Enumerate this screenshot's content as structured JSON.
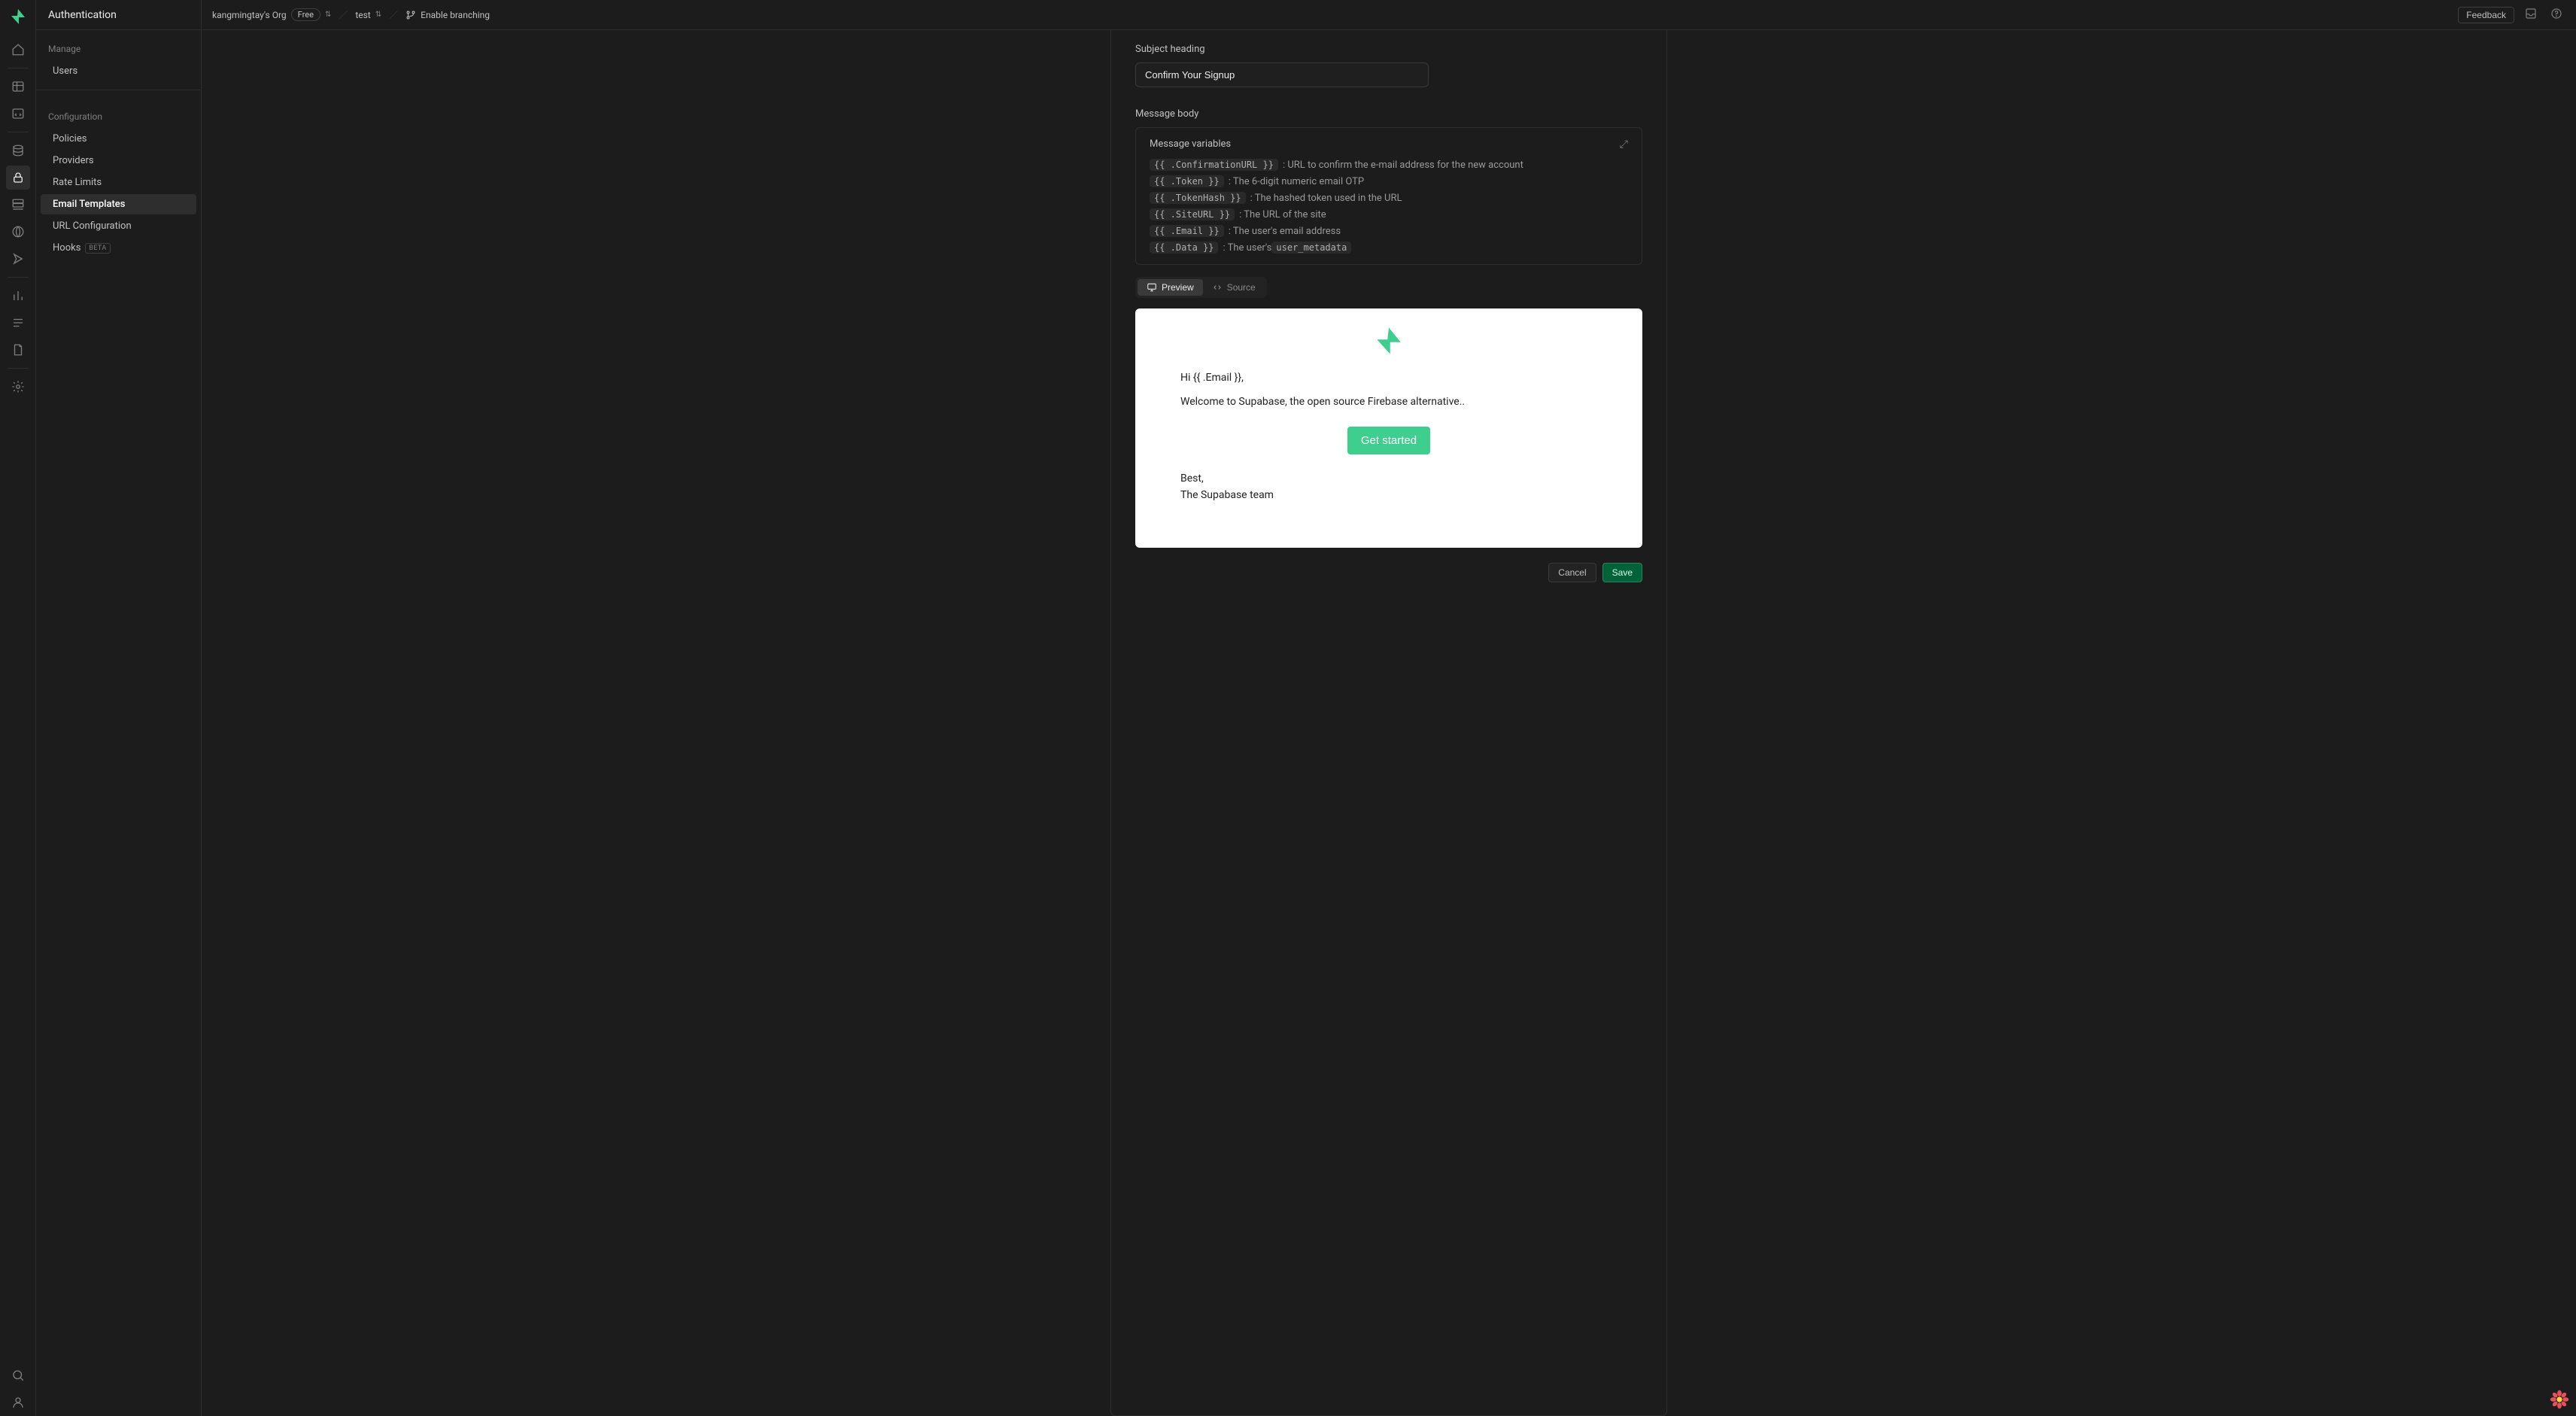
{
  "page_title": "Authentication",
  "topbar": {
    "org": "kangmingtay's Org",
    "plan": "Free",
    "project": "test",
    "branching_label": "Enable branching",
    "feedback_label": "Feedback"
  },
  "sidebar": {
    "sections": {
      "manage_label": "Manage",
      "config_label": "Configuration"
    },
    "manage": [
      {
        "label": "Users",
        "active": false
      }
    ],
    "config": [
      {
        "label": "Policies",
        "active": false
      },
      {
        "label": "Providers",
        "active": false
      },
      {
        "label": "Rate Limits",
        "active": false
      },
      {
        "label": "Email Templates",
        "active": true
      },
      {
        "label": "URL Configuration",
        "active": false
      },
      {
        "label": "Hooks",
        "active": false,
        "badge": "BETA"
      }
    ]
  },
  "form": {
    "subject_label": "Subject heading",
    "subject_value": "Confirm Your Signup",
    "body_label": "Message body",
    "vars_title": "Message variables",
    "variables": [
      {
        "token": "{{ .ConfirmationURL }}",
        "desc": ": URL to confirm the e-mail address for the new account"
      },
      {
        "token": "{{ .Token }}",
        "desc": ": The 6-digit numeric email OTP"
      },
      {
        "token": "{{ .TokenHash }}",
        "desc": ": The hashed token used in the URL"
      },
      {
        "token": "{{ .SiteURL }}",
        "desc": ": The URL of the site"
      },
      {
        "token": "{{ .Email }}",
        "desc": ": The user's email address"
      },
      {
        "token": "{{ .Data }}",
        "desc_pre": ": The user's ",
        "desc_code": "user_metadata"
      }
    ],
    "tabs": {
      "preview": "Preview",
      "source": "Source"
    },
    "actions": {
      "cancel": "Cancel",
      "save": "Save"
    }
  },
  "email_preview": {
    "greeting": "Hi {{ .Email }},",
    "intro": "Welcome to Supabase, the open source Firebase alternative..",
    "cta": "Get started",
    "sign_off_1": "Best,",
    "sign_off_2": "The Supabase team"
  },
  "colors": {
    "brand_green": "#3ecf8e"
  }
}
